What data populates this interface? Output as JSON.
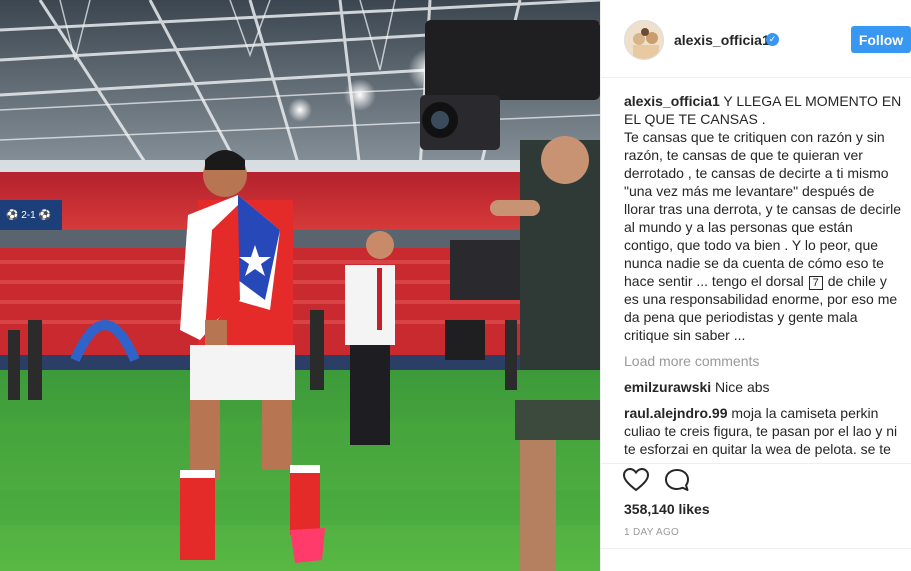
{
  "post": {
    "username": "alexis_officia1",
    "follow_label": "Follow",
    "verified_badge": "verified-badge-icon"
  },
  "caption": {
    "username": "alexis_officia1",
    "text_part1": "Y LLEGA EL MOMENTO EN EL QUE TE CANSAS .\nTe cansas que te critiquen con razón y sin razón, te cansas de que te quieran ver derrotado , te cansas de decirte a ti mismo \"una vez más me levantare\" después de llorar tras una derrota, y te cansas de decirle al mundo y a las personas que están contigo, que todo va bien . Y lo peor, que nunca nadie se da cuenta de cómo eso te hace sentir ... tengo el dorsal",
    "dorsal": "7",
    "text_part2": "de chile y es una responsabilidad enorme, por eso me da pena que periodistas y gente mala critique sin saber ..."
  },
  "load_more_label": "Load more comments",
  "comments": [
    {
      "username": "emilzurawski",
      "text": "Nice abs"
    },
    {
      "username": "raul.alejndro.99",
      "text": "moja la camiseta perkin culiao te creis figura, te pasan por el lao y ni te esforzai en quitar la wea de pelota. se te"
    }
  ],
  "likes": "358,140 likes",
  "timestamp": "1 DAY AGO",
  "colors": {
    "accent": "#3897f0",
    "text": "#262626",
    "muted": "#999999",
    "divider": "#efefef"
  }
}
